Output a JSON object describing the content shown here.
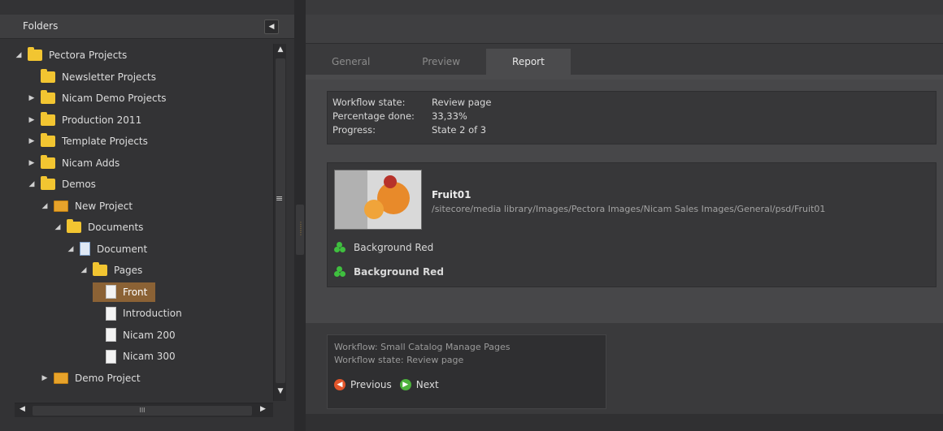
{
  "folders_panel": {
    "title": "Folders",
    "collapse_icon": "chevron-left-icon",
    "tree": [
      {
        "label": "Pectora Projects",
        "level": 0,
        "expanded": true,
        "icon": "folder-icon"
      },
      {
        "label": "Newsletter Projects",
        "level": 1,
        "expanded": null,
        "icon": "folder-icon"
      },
      {
        "label": "Nicam Demo Projects",
        "level": 1,
        "expanded": false,
        "icon": "folder-icon"
      },
      {
        "label": "Production 2011",
        "level": 1,
        "expanded": false,
        "icon": "folder-icon"
      },
      {
        "label": "Template Projects",
        "level": 1,
        "expanded": false,
        "icon": "folder-icon"
      },
      {
        "label": "Nicam Adds",
        "level": 1,
        "expanded": false,
        "icon": "folder-icon"
      },
      {
        "label": "Demos",
        "level": 1,
        "expanded": true,
        "icon": "folder-icon"
      },
      {
        "label": "New Project",
        "level": 2,
        "expanded": true,
        "icon": "project-icon"
      },
      {
        "label": "Documents",
        "level": 3,
        "expanded": true,
        "icon": "folder-icon"
      },
      {
        "label": "Document",
        "level": 4,
        "expanded": true,
        "icon": "document-icon"
      },
      {
        "label": "Pages",
        "level": 5,
        "expanded": true,
        "icon": "folder-icon"
      },
      {
        "label": "Front",
        "level": 6,
        "expanded": null,
        "icon": "page-icon",
        "selected": true
      },
      {
        "label": "Introduction",
        "level": 6,
        "expanded": null,
        "icon": "page-icon"
      },
      {
        "label": "Nicam 200",
        "level": 6,
        "expanded": null,
        "icon": "page-icon"
      },
      {
        "label": "Nicam 300",
        "level": 6,
        "expanded": null,
        "icon": "page-icon"
      },
      {
        "label": "Demo Project",
        "level": 2,
        "expanded": false,
        "icon": "project-icon"
      }
    ],
    "hscroll_grip": "III"
  },
  "tabs": [
    {
      "label": "General",
      "active": false
    },
    {
      "label": "Preview",
      "active": false
    },
    {
      "label": "Report",
      "active": true
    }
  ],
  "status": {
    "workflow_state_label": "Workflow state:",
    "workflow_state_value": "Review page",
    "percentage_label": "Percentage done:",
    "percentage_value": "33,33%",
    "progress_label": "Progress:",
    "progress_value": "State 2 of 3"
  },
  "item": {
    "title": "Fruit01",
    "path": "/sitecore/media library/Images/Pectora Images/Nicam Sales Images/General/psd/Fruit01",
    "fields": [
      {
        "label": "Background Red",
        "bold": false
      },
      {
        "label": "Background Red",
        "bold": true
      }
    ]
  },
  "workflow": {
    "workflow_line": "Workflow: Small Catalog Manage Pages",
    "state_line": "Workflow state: Review page",
    "previous_label": "Previous",
    "next_label": "Next"
  },
  "colors": {
    "selected_row": "#8b6235",
    "folder": "#f2c531",
    "active_tab": "#4b4b4d"
  }
}
